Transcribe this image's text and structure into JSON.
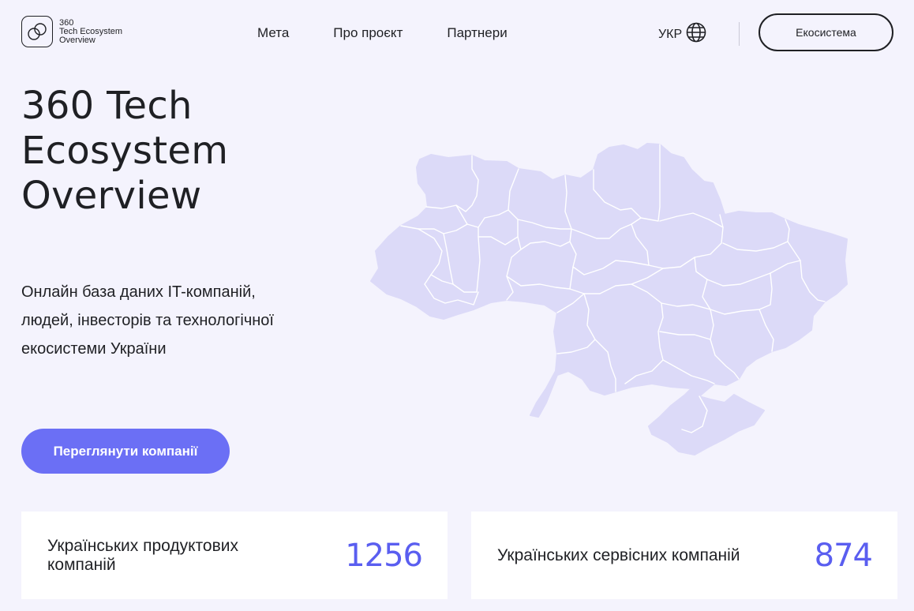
{
  "header": {
    "logo": {
      "line1": "360",
      "line2": "Tech Ecosystem",
      "line3": "Overview"
    },
    "nav": [
      {
        "label": "Мета"
      },
      {
        "label": "Про проєкт"
      },
      {
        "label": "Партнери"
      }
    ],
    "language": {
      "label": "УКР",
      "icon": "globe-icon"
    },
    "ecosystem_button": "Екосистема"
  },
  "hero": {
    "title_lines": [
      "360 Tech",
      "Ecosystem",
      "Overview"
    ],
    "description": "Онлайн база даних IT-компаній, людей, інвесторів та технологічної екосистеми України",
    "cta": "Переглянути компанії",
    "map_icon": "ukraine-map"
  },
  "stats": [
    {
      "label": "Українських продуктових компаній",
      "value": "1256"
    },
    {
      "label": "Українських сервісних компаній",
      "value": "874"
    }
  ],
  "colors": {
    "background": "#f4f3fd",
    "accent": "#6b6ff5",
    "stat_number": "#5a5ef0",
    "map_fill": "#dcdaf8",
    "text": "#1f2024"
  }
}
